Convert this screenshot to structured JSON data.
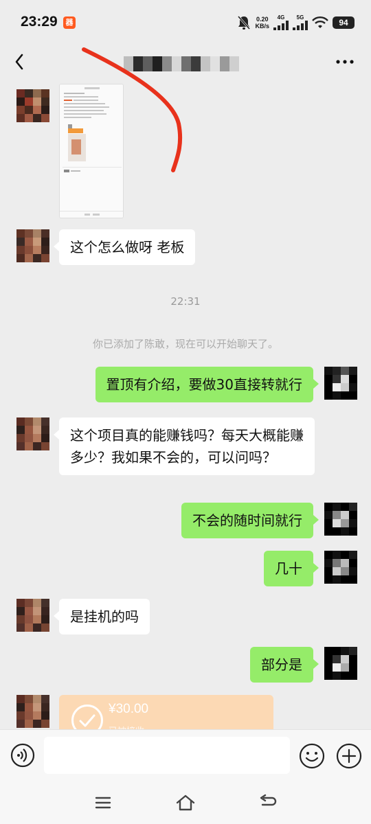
{
  "status_bar": {
    "time": "23:29",
    "app_badge": "器",
    "net_speed_value": "0.20",
    "net_speed_unit": "KB/s",
    "signal1_label": "4G",
    "signal2_label": "5G",
    "battery": "94"
  },
  "chat": {
    "messages": [
      {
        "text": "这个怎么做呀 老板"
      },
      {
        "text": "22:31"
      },
      {
        "text": "你已添加了陈敢，现在可以开始聊天了。"
      },
      {
        "text": "置顶有介绍，要做30直接转就行"
      },
      {
        "text": "这个项目真的能赚钱吗？每天大概能赚多少？我如果不会的，可以问吗？"
      },
      {
        "text": "不会的随时间就行"
      },
      {
        "text": "几十"
      },
      {
        "text": "是挂机的吗"
      },
      {
        "text": "部分是"
      }
    ],
    "transfer_amount": "¥30.00",
    "transfer_sub": "已被接收"
  },
  "input": {
    "placeholder": ""
  },
  "icons": {
    "back": "chevron-left-icon",
    "more": "more-icon",
    "voice": "voice-icon",
    "emoji": "emoji-icon",
    "plus": "plus-icon",
    "menu": "menu-icon",
    "home": "home-icon",
    "back_nav": "back-nav-icon"
  },
  "colors": {
    "background": "#ededed",
    "outgoing_bubble": "#95ec69",
    "incoming_bubble": "#ffffff",
    "transfer_card": "#fcd9b4",
    "annotation_stroke": "#e8321c"
  }
}
